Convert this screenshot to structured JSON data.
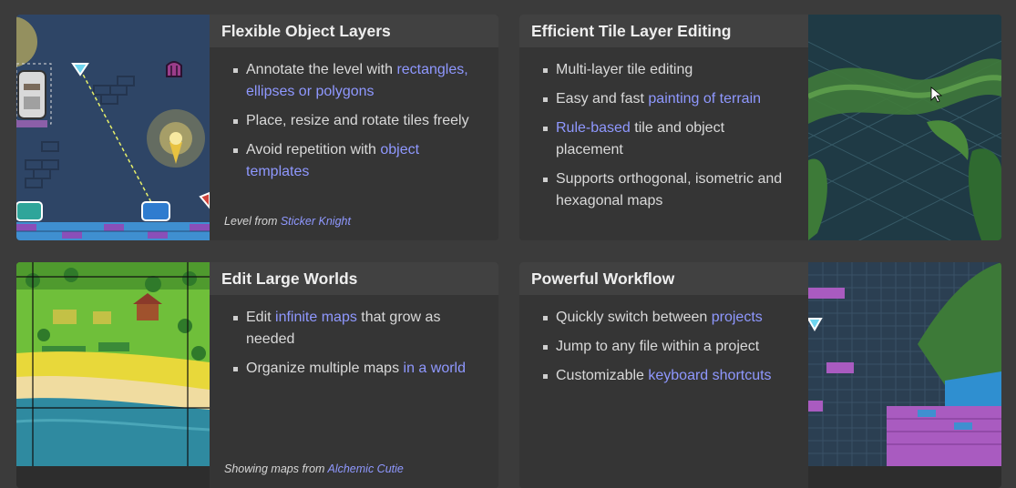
{
  "cards": [
    {
      "title": "Flexible Object Layers",
      "items": [
        {
          "text": "Annotate the level with ",
          "link": "rectangles, ellipses or polygons",
          "after": ""
        },
        {
          "text": "Place, resize and rotate tiles freely",
          "link": "",
          "after": ""
        },
        {
          "text": "Avoid repetition with ",
          "link": "object templates",
          "after": ""
        }
      ],
      "caption": {
        "text": "Level from ",
        "link": "Sticker Knight"
      }
    },
    {
      "title": "Efficient Tile Layer Editing",
      "items": [
        {
          "text": "Multi-layer tile editing",
          "link": "",
          "after": ""
        },
        {
          "text": "Easy and fast ",
          "link": "painting of terrain",
          "after": ""
        },
        {
          "text": "",
          "link": "Rule-based",
          "after": " tile and object placement"
        },
        {
          "text": "Supports orthogonal, isometric and hexagonal maps",
          "link": "",
          "after": ""
        }
      ]
    },
    {
      "title": "Edit Large Worlds",
      "items": [
        {
          "text": "Edit ",
          "link": "infinite maps",
          "after": " that grow as needed"
        },
        {
          "text": "Organize multiple maps ",
          "link": "in a world",
          "after": ""
        }
      ],
      "caption": {
        "text": "Showing maps from ",
        "link": "Alchemic Cutie"
      }
    },
    {
      "title": "Powerful Workflow",
      "items": [
        {
          "text": "Quickly switch between ",
          "link": "projects",
          "after": ""
        },
        {
          "text": "Jump to any file within a project",
          "link": "",
          "after": ""
        },
        {
          "text": "Customizable ",
          "link": "keyboard shortcuts",
          "after": ""
        }
      ]
    }
  ],
  "colors": {
    "background": "#3b3b3b",
    "card": "#2d2d2d",
    "header": "#414141",
    "link": "#8f98ff",
    "text": "#d9d9d9"
  },
  "icons": [
    "gem-icon",
    "door-icon",
    "lamp-icon",
    "knight-sprite",
    "mouse-cursor-icon"
  ]
}
